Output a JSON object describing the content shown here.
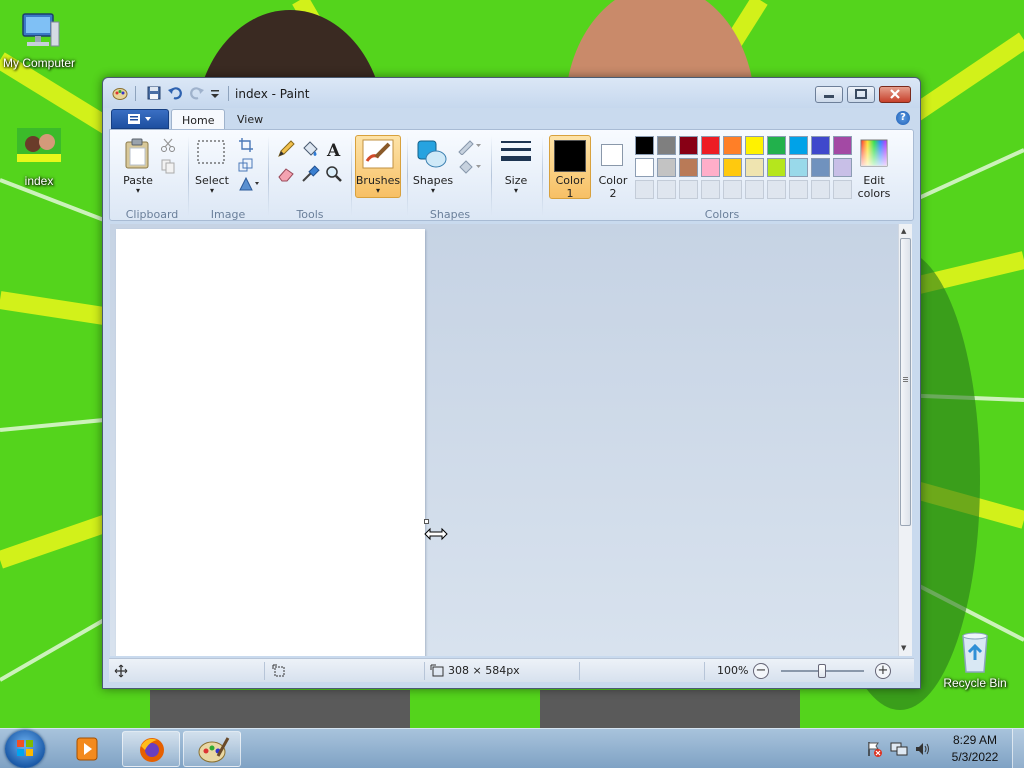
{
  "desktop": {
    "icons": [
      {
        "label": "My Computer",
        "icon": "computer-icon"
      },
      {
        "label": "index",
        "icon": "image-file-icon"
      },
      {
        "label": "Recycle Bin",
        "icon": "recycle-bin-icon"
      }
    ]
  },
  "window": {
    "title": "index - Paint",
    "tabs": {
      "home": "Home",
      "view": "View"
    },
    "ribbon": {
      "paste": "Paste",
      "select": "Select",
      "brushes": "Brushes",
      "shapes": "Shapes",
      "size": "Size",
      "color1": "Color 1",
      "color1_line1": "Color",
      "color1_line2": "1",
      "color2_line1": "Color",
      "color2_line2": "2",
      "edit_colors_line1": "Edit",
      "edit_colors_line2": "colors",
      "groups": {
        "clipboard": "Clipboard",
        "image": "Image",
        "tools": "Tools",
        "shapes": "Shapes",
        "colors": "Colors"
      }
    },
    "palette_row1": [
      "#000000",
      "#7f7f7f",
      "#880015",
      "#ed1c24",
      "#ff7f27",
      "#fff200",
      "#22b14c",
      "#00a2e8",
      "#3f48cc",
      "#a349a4"
    ],
    "palette_row2": [
      "#ffffff",
      "#c3c3c3",
      "#b97a57",
      "#ffaec9",
      "#ffc90e",
      "#efe4b0",
      "#b5e61d",
      "#99d9ea",
      "#7092be",
      "#c8bfe7"
    ],
    "color1_value": "#000000",
    "color2_value": "#ffffff",
    "status": {
      "dimensions": "308 × 584px",
      "zoom": "100%"
    }
  },
  "taskbar": {
    "time": "8:29 AM",
    "date": "5/3/2022"
  }
}
